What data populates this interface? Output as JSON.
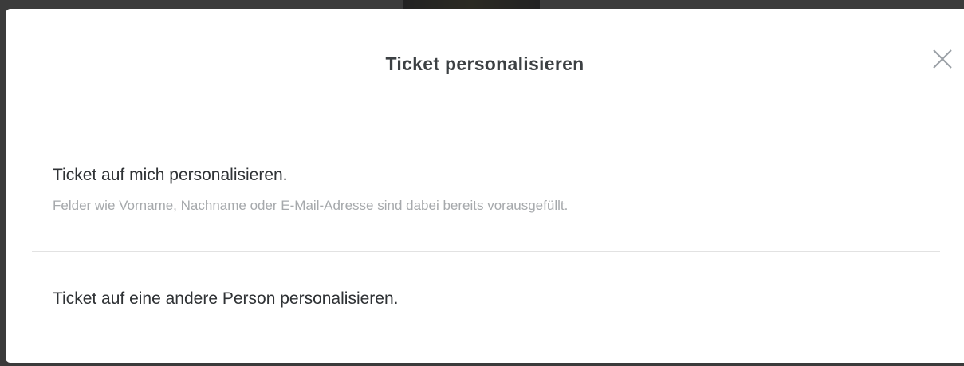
{
  "dialog": {
    "title": "Ticket personalisieren",
    "close_icon": "close-icon"
  },
  "options": [
    {
      "label": "Ticket auf mich personalisieren.",
      "hint": "Felder wie Vorname, Nachname oder E-Mail-Adresse sind dabei bereits vorausgefüllt."
    },
    {
      "label": "Ticket auf eine andere Person personalisieren."
    }
  ],
  "colors": {
    "backdrop": "#3b3b3b",
    "title": "#3c4043",
    "label": "#2f3235",
    "hint": "#a6a9ac",
    "divider": "#e2e2e2"
  }
}
